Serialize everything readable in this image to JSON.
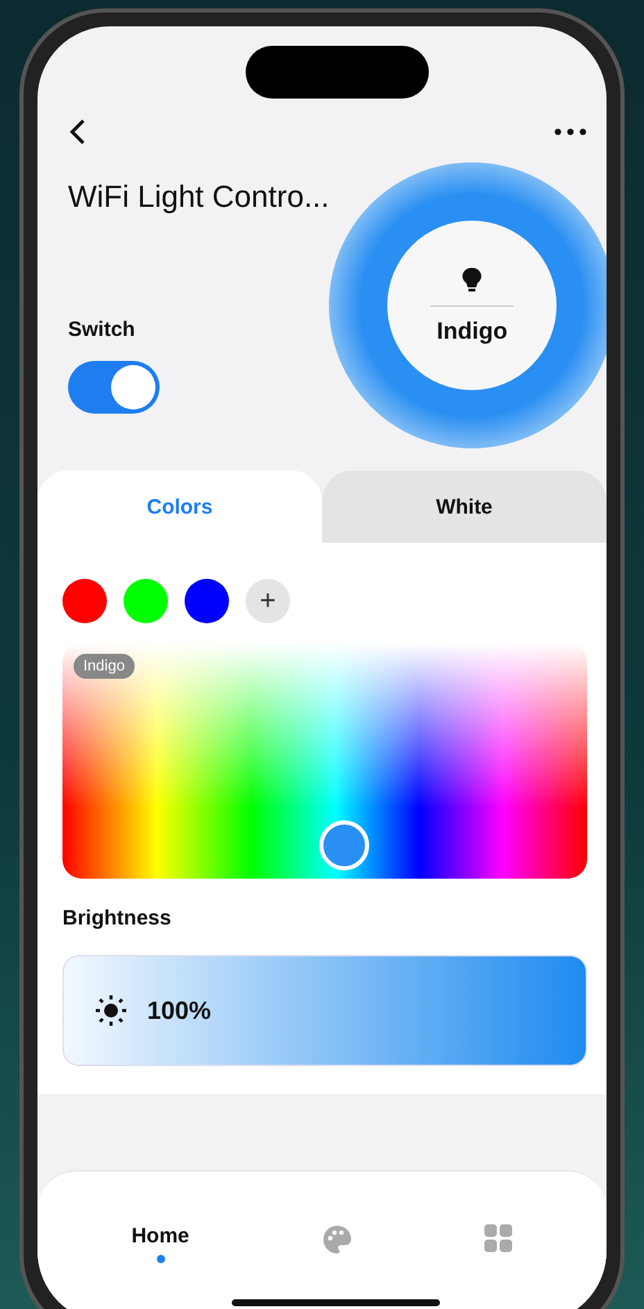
{
  "title": "WiFi Light Contro...",
  "switch": {
    "label": "Switch",
    "on": true
  },
  "bulb": {
    "label": "Indigo"
  },
  "tabs": [
    {
      "label": "Colors",
      "selected": true
    },
    {
      "label": "White",
      "selected": false
    }
  ],
  "swatches": [
    {
      "color": "#ff0000"
    },
    {
      "color": "#00ff00"
    },
    {
      "color": "#0000ff"
    }
  ],
  "add_button": "+",
  "picker": {
    "tag": "Indigo"
  },
  "brightness": {
    "label": "Brightness",
    "reading": "100%",
    "level": 1
  },
  "nav": [
    {
      "kind": "home",
      "label": "Home",
      "selected": true
    },
    {
      "kind": "palette",
      "selected": false
    },
    {
      "kind": "grid",
      "selected": false
    }
  ]
}
